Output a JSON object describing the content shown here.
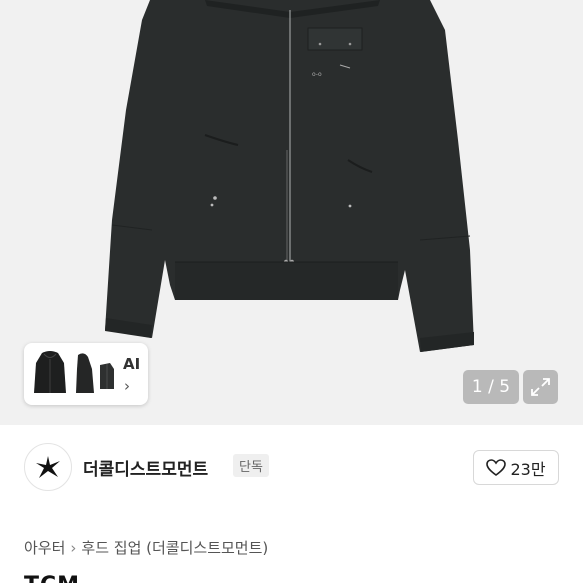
{
  "gallery": {
    "ai_label": "AI",
    "ai_chevron": "›",
    "counter": "1 / 5",
    "expand_icon": "expand-icon"
  },
  "seller": {
    "name": "더콜디스트모먼트",
    "badge": "단독",
    "like_count": "23만",
    "avatar_icon": "star-logo-icon"
  },
  "breadcrumb": {
    "items": [
      "아우터",
      "후드 집업 (더콜디스트모먼트)"
    ],
    "separator": "›"
  },
  "product": {
    "title_partial": "TCM"
  },
  "colors": {
    "hero_bg": "#f1f1f1",
    "jacket": "#2a2d2d",
    "counter_bg": "#b9b9b9"
  }
}
